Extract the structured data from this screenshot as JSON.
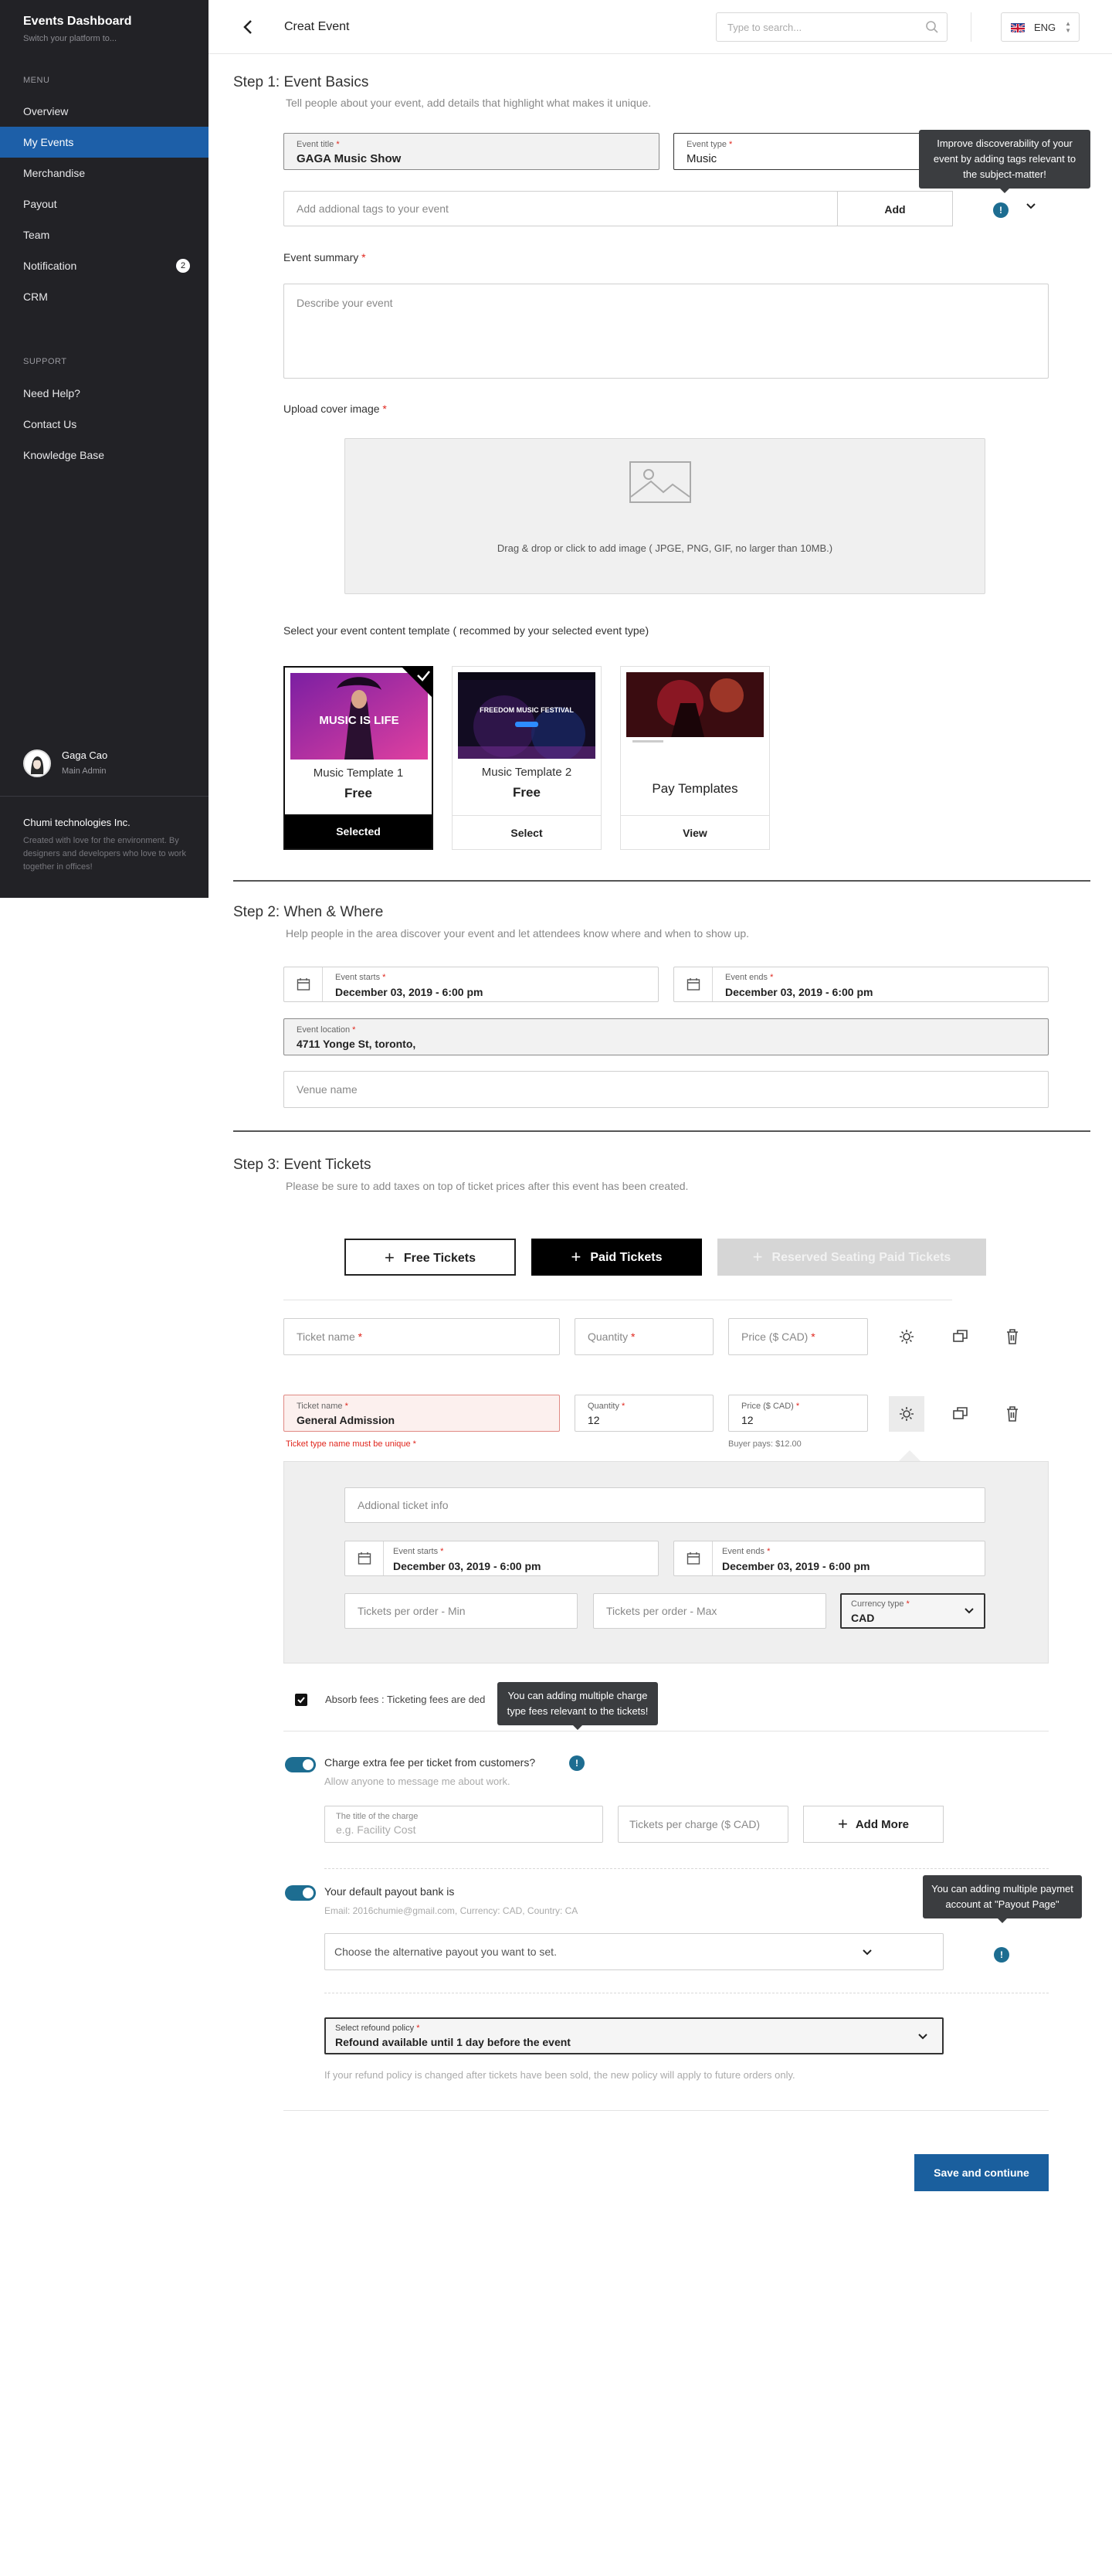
{
  "colors": {
    "sidebar_bg": "#222226",
    "active_item": "#1d5fa8",
    "primary_button": "#1a5f9e",
    "accent_teal": "#1d6d91",
    "error": "#e0261d"
  },
  "sidebar": {
    "brand": "Events Dashboard",
    "brand_sub": "Switch your platform to...",
    "menu_heading": "MENU",
    "items": [
      {
        "label": "Overview"
      },
      {
        "label": "My Events",
        "active": true
      },
      {
        "label": "Merchandise"
      },
      {
        "label": "Payout"
      },
      {
        "label": "Team"
      },
      {
        "label": "Notification",
        "badge": "2"
      },
      {
        "label": "CRM"
      }
    ],
    "support_heading": "SUPPORT",
    "support_items": [
      {
        "label": "Need Help?"
      },
      {
        "label": "Contact Us"
      },
      {
        "label": "Knowledge Base"
      }
    ],
    "user": {
      "name": "Gaga Cao",
      "role": "Main Admin"
    },
    "company": "Chumi technologies Inc.",
    "footer": "Created with love for the environment. By designers and developers who love to work together in offices!"
  },
  "header": {
    "title": "Creat Event",
    "search_placeholder": "Type to search...",
    "language": "ENG",
    "icons": {
      "back": "chevron-left-icon",
      "search": "search-icon",
      "flag": "uk-flag-icon"
    }
  },
  "step1": {
    "title": "Step 1: Event Basics",
    "subtitle": "Tell people about your event, add details that highlight what makes it unique.",
    "event_title_label": "Event title",
    "event_title_value": "GAGA Music Show",
    "event_type_label": "Event type",
    "event_type_value": "Music",
    "tags_placeholder": "Add addional tags to your event",
    "add_button": "Add",
    "tags_tooltip": "Improve discoverability of your event by adding tags relevant to the subject-matter!",
    "summary_label": "Event summary",
    "summary_placeholder": "Describe your event",
    "cover_label": "Upload cover image",
    "cover_hint": "Drag & drop or click to add image ( JPGE, PNG, GIF, no larger than 10MB.)",
    "template_label": "Select your event content template ( recommed by your selected event type)",
    "templates": [
      {
        "name": "Music Template 1",
        "price": "Free",
        "action": "Selected",
        "selected": true,
        "image_text": "MUSIC IS LIFE"
      },
      {
        "name": "Music Template 2",
        "price": "Free",
        "action": "Select",
        "selected": false,
        "image_text": "FREEDOM MUSIC FESTIVAL"
      },
      {
        "name": "Pay Templates",
        "price": "",
        "action": "View",
        "selected": false,
        "image_text": ""
      }
    ]
  },
  "step2": {
    "title": "Step 2: When & Where",
    "subtitle": "Help people in the area discover your event and let attendees know where and when to show up.",
    "starts_label": "Event starts",
    "starts_value": "December 03, 2019 - 6:00 pm",
    "ends_label": "Event ends",
    "ends_value": "December 03, 2019 - 6:00 pm",
    "location_label": "Event location",
    "location_value": "4711 Yonge St, toronto,",
    "venue_placeholder": "Venue name"
  },
  "step3": {
    "title": "Step 3: Event Tickets",
    "subtitle": "Please be sure to add taxes on top of ticket prices after this event has been created.",
    "free_button": "Free Tickets",
    "paid_button": "Paid Tickets",
    "reserved_button": "Reserved Seating Paid Tickets",
    "ticket_name_placeholder": "Ticket name",
    "quantity_placeholder": "Quantity",
    "price_placeholder": "Price ($ CAD)",
    "ticket_name_label": "Ticket name",
    "ticket_name_value": "General Admission",
    "quantity_label": "Quantity",
    "quantity_value": "12",
    "price_label": "Price ($ CAD)",
    "price_value": "12",
    "error_text": "Ticket type name must be unique",
    "buyer_pays": "Buyer pays: $12.00",
    "info_placeholder": "Addional ticket info",
    "detail_starts_label": "Event starts",
    "detail_starts_value": "December 03, 2019 - 6:00 pm",
    "detail_ends_label": "Event ends",
    "detail_ends_value": "December 03, 2019 - 6:00 pm",
    "min_placeholder": "Tickets per order - Min",
    "max_placeholder": "Tickets per order - Max",
    "currency_label": "Currency type",
    "currency_value": "CAD",
    "absorb_text": "Absorb fees : Ticketing fees are ded",
    "charge_tooltip": "You can adding multiple charge type fees relevant to the tickets!",
    "charge_title": "Charge extra fee per ticket from customers?",
    "charge_sub": "Allow anyone to message me about work.",
    "charge_title_label": "The title of the charge",
    "charge_title_placeholder": "e.g. Facility Cost",
    "per_charge_placeholder": "Tickets per charge ($ CAD)",
    "add_more": "Add More",
    "payout_title": "Your default payout bank is",
    "payout_sub": "Email: 2016chumie@gmail.com, Currency: CAD, Country: CA",
    "payout_tooltip": "You can adding multiple paymet account at \"Payout Page\"",
    "payout_select_placeholder": "Choose the alternative payout you want to set.",
    "refund_label": "Select refound policy",
    "refund_value": "Refound available until 1 day before the event",
    "refund_note": "If your refund policy is changed after tickets have been sold, the new policy will apply to future orders only.",
    "save_button": "Save and contiune"
  }
}
